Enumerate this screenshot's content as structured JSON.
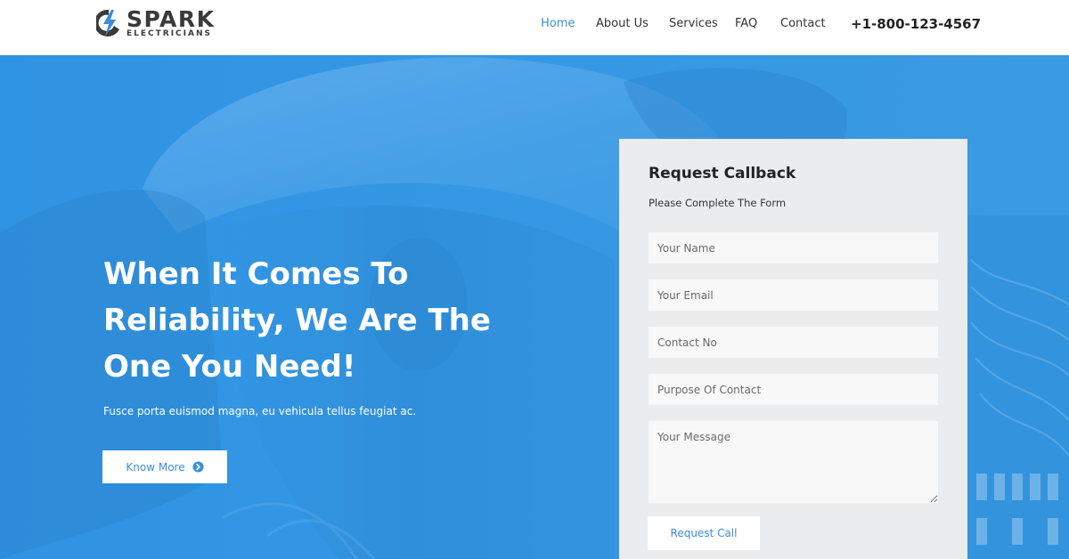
{
  "brand": {
    "name": "SPARK",
    "tagline": "ELECTRICIANS",
    "accent_color": "#3a8fd6",
    "icon": "lightning-bolt-icon"
  },
  "nav": {
    "items": [
      {
        "label": "Home",
        "active": true
      },
      {
        "label": "About Us",
        "active": false
      },
      {
        "label": "Services",
        "active": false
      },
      {
        "label": "FAQ",
        "active": false
      },
      {
        "label": "Contact",
        "active": false
      }
    ],
    "phone": "+1-800-123-4567"
  },
  "hero": {
    "title": "When It Comes To Reliability, We Are The One You Need!",
    "subtitle": "Fusce porta euismod magna, eu vehicula tellus feugiat ac.",
    "button_label": "Know More",
    "button_icon": "arrow-right-circle-icon",
    "overlay_color": "#3598e4"
  },
  "form": {
    "title": "Request Callback",
    "subtitle": "Please Complete The Form",
    "fields": {
      "name_placeholder": "Your Name",
      "email_placeholder": "Your Email",
      "contact_placeholder": "Contact No",
      "purpose_placeholder": "Purpose Of Contact",
      "message_placeholder": "Your Message"
    },
    "submit_label": "Request Call"
  }
}
